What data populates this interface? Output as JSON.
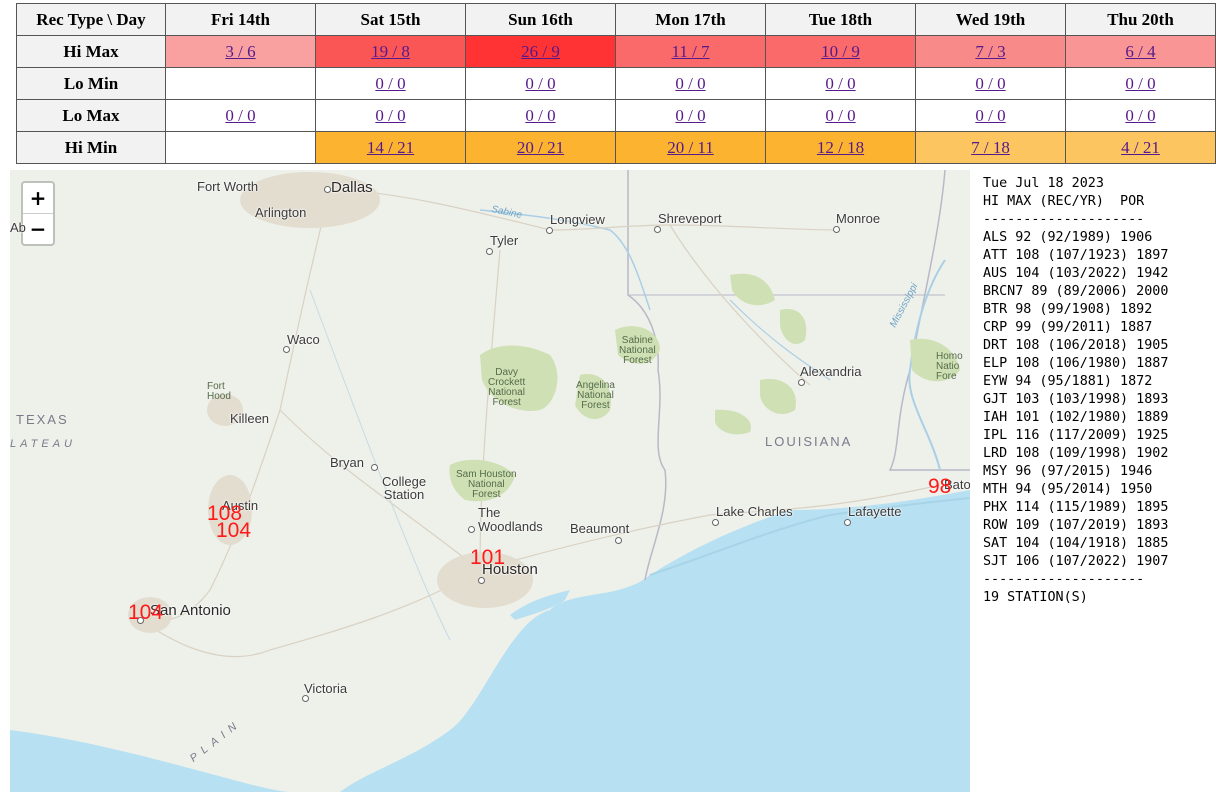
{
  "table": {
    "corner": "Rec Type \\ Day",
    "days": [
      "Fri 14th",
      "Sat 15th",
      "Sun 16th",
      "Mon 17th",
      "Tue 18th",
      "Wed 19th",
      "Thu 20th"
    ],
    "rows": [
      {
        "label": "Hi Max",
        "cells": [
          {
            "text": "3 / 6",
            "bg": "#f9a0a0"
          },
          {
            "text": "19 / 8",
            "bg": "#fb5656"
          },
          {
            "text": "26 / 9",
            "bg": "#ff3333"
          },
          {
            "text": "11 / 7",
            "bg": "#fa6a6a"
          },
          {
            "text": "10 / 9",
            "bg": "#fa6a6a"
          },
          {
            "text": "7 / 3",
            "bg": "#f98a8a"
          },
          {
            "text": "6 / 4",
            "bg": "#f99595"
          }
        ]
      },
      {
        "label": "Lo Min",
        "cells": [
          {
            "text": "",
            "bg": "#ffffff"
          },
          {
            "text": "0 / 0",
            "bg": "#ffffff"
          },
          {
            "text": "0 / 0",
            "bg": "#ffffff"
          },
          {
            "text": "0 / 0",
            "bg": "#ffffff"
          },
          {
            "text": "0 / 0",
            "bg": "#ffffff"
          },
          {
            "text": "0 / 0",
            "bg": "#ffffff"
          },
          {
            "text": "0 / 0",
            "bg": "#ffffff"
          }
        ]
      },
      {
        "label": "Lo Max",
        "cells": [
          {
            "text": "0 / 0",
            "bg": "#ffffff"
          },
          {
            "text": "0 / 0",
            "bg": "#ffffff"
          },
          {
            "text": "0 / 0",
            "bg": "#ffffff"
          },
          {
            "text": "0 / 0",
            "bg": "#ffffff"
          },
          {
            "text": "0 / 0",
            "bg": "#ffffff"
          },
          {
            "text": "0 / 0",
            "bg": "#ffffff"
          },
          {
            "text": "0 / 0",
            "bg": "#ffffff"
          }
        ]
      },
      {
        "label": "Hi Min",
        "cells": [
          {
            "text": "",
            "bg": "#ffffff"
          },
          {
            "text": "14 / 21",
            "bg": "#fbb330"
          },
          {
            "text": "20 / 21",
            "bg": "#fbb330"
          },
          {
            "text": "20 / 11",
            "bg": "#fbb330"
          },
          {
            "text": "12 / 18",
            "bg": "#fbb330"
          },
          {
            "text": "7 / 18",
            "bg": "#fcc560"
          },
          {
            "text": "4 / 21",
            "bg": "#fcc560"
          }
        ]
      }
    ]
  },
  "map": {
    "zoom_in": "+",
    "zoom_out": "−",
    "places": {
      "fort_worth": "Fort Worth",
      "dallas": "Dallas",
      "arlington": "Arlington",
      "longview": "Longview",
      "shreveport": "Shreveport",
      "monroe": "Monroe",
      "tyler": "Tyler",
      "waco": "Waco",
      "alexandria": "Alexandria",
      "fort_hood": "Fort\nHood",
      "killeen": "Killeen",
      "texas": "TEXAS",
      "plateau": "LATEAU",
      "louisiana": "LOUISIANA",
      "bryan": "Bryan",
      "college_station": "College\nStation",
      "austin": "Austin",
      "the_woodlands": "The\nWoodlands",
      "beaumont": "Beaumont",
      "lake_charles": "Lake Charles",
      "lafayette": "Lafayette",
      "houston": "Houston",
      "san_antonio": "San Antonio",
      "victoria": "Victoria",
      "plain": "PLAIN",
      "baton": "Baton",
      "ab": "Ab",
      "sabine_river": "Sabine",
      "mississippi": "Mississippi"
    },
    "forests": {
      "sabine": "Sabine\nNational\nForest",
      "davy_crockett": "Davy\nCrockett\nNational\nForest",
      "angelina": "Angelina\nNational\nForest",
      "sam_houston": "Sam Houston\nNational\nForest",
      "homochitto": "Homo\nNatio\nFore"
    },
    "values": {
      "austin_1": "108",
      "austin_2": "104",
      "houston": "101",
      "san_antonio": "104",
      "baton_rouge": "98"
    }
  },
  "report": {
    "date": "Tue Jul 18 2023",
    "header": "HI MAX (REC/YR)  POR",
    "divider": "--------------------",
    "stations": [
      "ALS 92 (92/1989) 1906",
      "ATT 108 (107/1923) 1897",
      "AUS 104 (103/2022) 1942",
      "BRCN7 89 (89/2006) 2000",
      "BTR 98 (99/1908) 1892",
      "CRP 99 (99/2011) 1887",
      "DRT 108 (106/2018) 1905",
      "ELP 108 (106/1980) 1887",
      "EYW 94 (95/1881) 1872",
      "GJT 103 (103/1998) 1893",
      "IAH 101 (102/1980) 1889",
      "IPL 116 (117/2009) 1925",
      "LRD 108 (109/1998) 1902",
      "MSY 96 (97/2015) 1946",
      "MTH 94 (95/2014) 1950",
      "PHX 114 (115/1989) 1895",
      "ROW 109 (107/2019) 1893",
      "SAT 104 (104/1918) 1885",
      "SJT 106 (107/2022) 1907"
    ],
    "footer": "19 STATION(S)"
  },
  "colors": {
    "record_value": "#ff1a1a",
    "link": "#551a8b",
    "gulf": "#b7e0f2",
    "forest": "#cfe0b4"
  }
}
